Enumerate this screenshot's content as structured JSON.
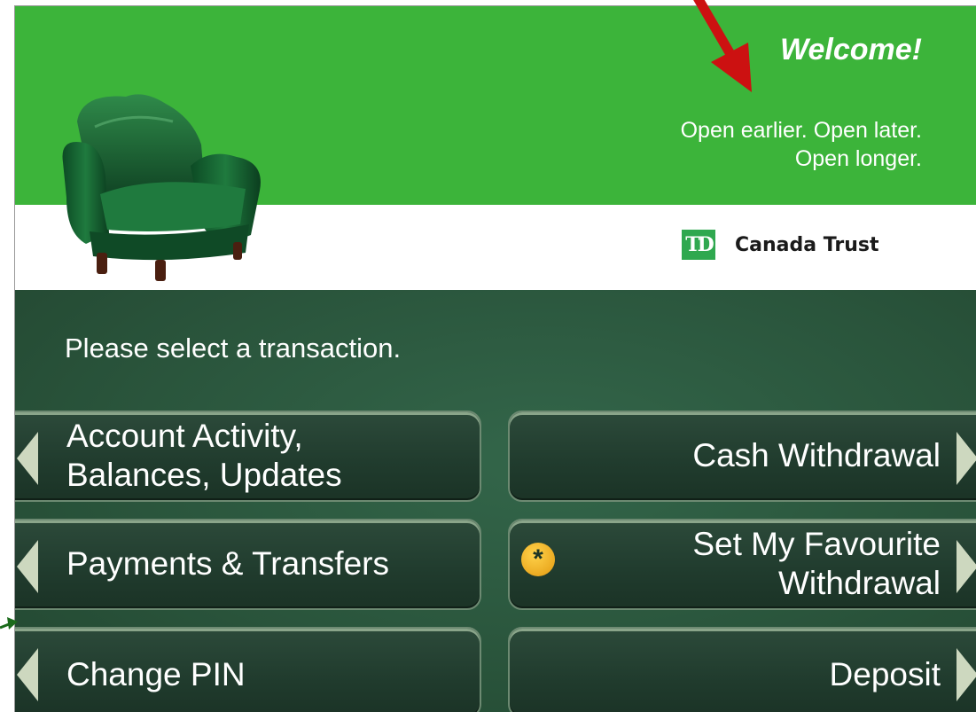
{
  "header": {
    "welcome": "Welcome!",
    "slogan_line1": "Open earlier.  Open later.",
    "slogan_line2": "Open longer.",
    "logo_mark": "TD",
    "logo_text": "Canada Trust"
  },
  "prompt": "Please select a transaction.",
  "buttons": {
    "account_activity_line1": "Account Activity,",
    "account_activity_line2": "Balances, Updates",
    "cash_withdrawal": "Cash Withdrawal",
    "payments_transfers": "Payments & Transfers",
    "favourite_line1": "Set My Favourite",
    "favourite_line2": "Withdrawal",
    "change_pin": "Change PIN",
    "deposit": "Deposit"
  },
  "icons": {
    "favourite": "star-badge-icon",
    "chair": "armchair-icon"
  },
  "colors": {
    "brand_green": "#3cb43a",
    "panel_green": "#2a553c",
    "annotation_red": "#cc1111",
    "annotation_green": "#1b6b1b"
  }
}
